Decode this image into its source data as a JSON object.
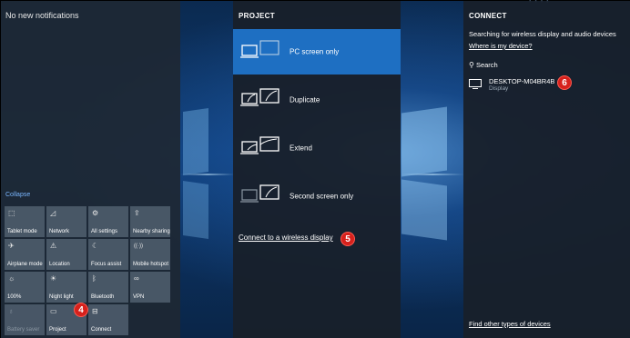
{
  "notifications": {
    "empty_text": "No new notifications"
  },
  "action_center": {
    "collapse_label": "Collapse",
    "tiles": [
      {
        "label": "Tablet mode",
        "icon": "⬚"
      },
      {
        "label": "Network",
        "icon": "◿"
      },
      {
        "label": "All settings",
        "icon": "⚙"
      },
      {
        "label": "Nearby sharing",
        "icon": "⇪"
      },
      {
        "label": "Airplane mode",
        "icon": "✈"
      },
      {
        "label": "Location",
        "icon": "⚠"
      },
      {
        "label": "Focus assist",
        "icon": "☾"
      },
      {
        "label": "Mobile hotspot",
        "icon": "((·))"
      },
      {
        "label": "100%",
        "icon": "☼"
      },
      {
        "label": "Night light",
        "icon": "☀"
      },
      {
        "label": "Bluetooth",
        "icon": "ᛒ"
      },
      {
        "label": "VPN",
        "icon": "∞"
      },
      {
        "label": "Battery saver",
        "icon": "♁"
      },
      {
        "label": "Project",
        "icon": "▭"
      },
      {
        "label": "Connect",
        "icon": "⊟"
      }
    ]
  },
  "project": {
    "title": "PROJECT",
    "options": [
      {
        "label": "PC screen only"
      },
      {
        "label": "Duplicate"
      },
      {
        "label": "Extend"
      },
      {
        "label": "Second screen only"
      }
    ],
    "wireless_link": "Connect to a wireless display"
  },
  "connect": {
    "title": "CONNECT",
    "searching_text": "Searching for wireless display and audio devices",
    "help_link": "Where is my device?",
    "search_label": "Search",
    "device": {
      "name": "DESKTOP-M04BR4B",
      "type": "Display"
    },
    "other_link": "Find other types of devices"
  },
  "callouts": {
    "project_tile": "4",
    "wireless_link": "5",
    "device": "6"
  },
  "colors": {
    "accent": "#1e6fc2",
    "callout": "#d6211c",
    "link": "#7ab7ff"
  }
}
